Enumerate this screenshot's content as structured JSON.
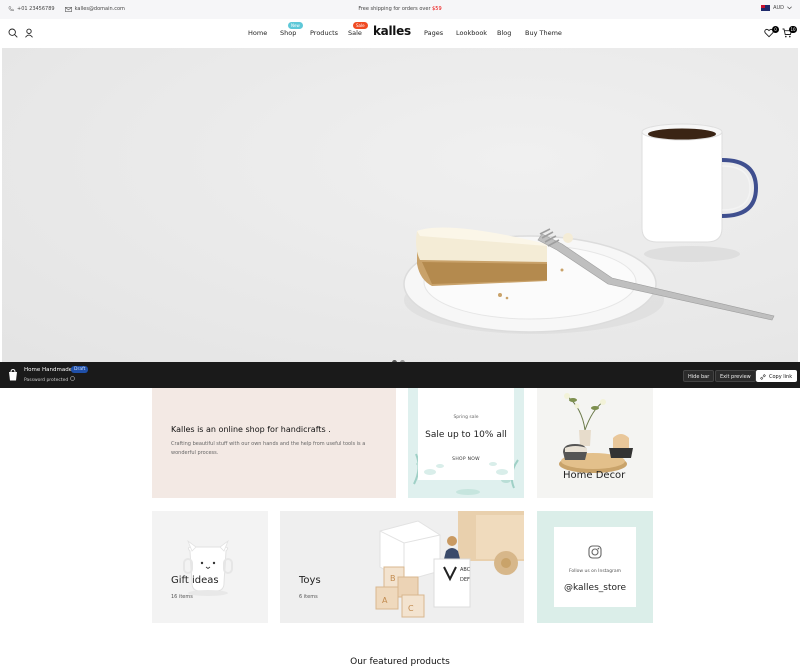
{
  "topbar": {
    "phone": "+01 23456789",
    "email": "kalles@domain.com",
    "promo_text": "Free shipping for orders over",
    "promo_price": "$59",
    "currency": "AUD"
  },
  "header": {
    "nav": [
      {
        "label": "Home"
      },
      {
        "label": "Shop",
        "badge": "New"
      },
      {
        "label": "Products"
      },
      {
        "label": "Sale",
        "badge": "Sale"
      },
      {
        "label": "Pages"
      },
      {
        "label": "Lookbook"
      },
      {
        "label": "Blog"
      },
      {
        "label": "Buy Theme"
      }
    ],
    "logo": "kalles",
    "wishlist_count": "0",
    "cart_count": "10"
  },
  "admin_bar": {
    "title": "Home Handmade",
    "status": "Draft",
    "subtitle": "Password protected",
    "hide_bar": "Hide bar",
    "exit_preview": "Exit preview",
    "copy_link": "Copy link"
  },
  "intro": {
    "heading": "Kalles is an online shop for handicrafts .",
    "text": "Crafting beautiful stuff with our own hands and the help from useful tools is a wonderful process."
  },
  "sale_card": {
    "kicker": "Spring sale",
    "headline": "Sale up to 10% all",
    "cta": "SHOP NOW"
  },
  "categories": [
    {
      "title": "Home Decor"
    },
    {
      "title": "Gift ideas",
      "count": "16 items"
    },
    {
      "title": "Toys",
      "count": "6 items"
    }
  ],
  "instagram": {
    "follow": "Follow us on Instagram",
    "handle": "@kalles_store"
  },
  "featured_heading": "Our featured products",
  "colors": {
    "accent_red": "#ec0101",
    "badge_new": "#5ec8d8",
    "badge_sale": "#f04b23",
    "admin_bar": "#1a1a1a",
    "intro_bg": "#f3e9e4"
  }
}
